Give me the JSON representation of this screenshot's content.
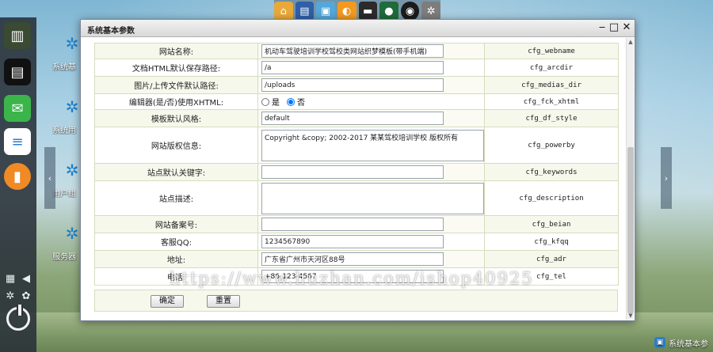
{
  "window": {
    "title": "系统基本参数"
  },
  "form": {
    "rows": [
      {
        "label": "网站名称:",
        "value": "机动车驾驶培训学校驾校类网站织梦模板(带手机端)",
        "key": "cfg_webname",
        "type": "text"
      },
      {
        "label": "文档HTML默认保存路径:",
        "value": "/a",
        "key": "cfg_arcdir",
        "type": "text"
      },
      {
        "label": "图片/上传文件默认路径:",
        "value": "/uploads",
        "key": "cfg_medias_dir",
        "type": "text"
      },
      {
        "label": "编辑器(是/否)使用XHTML:",
        "key": "cfg_fck_xhtml",
        "type": "radio",
        "option_yes": "是",
        "option_no": "否",
        "selected": "否"
      },
      {
        "label": "模板默认风格:",
        "value": "default",
        "key": "cfg_df_style",
        "type": "text"
      },
      {
        "label": "网站版权信息:",
        "value": "Copyright &copy; 2002-2017 某某驾校培训学校 版权所有",
        "key": "cfg_powerby",
        "type": "textarea"
      },
      {
        "label": "站点默认关键字:",
        "value": "",
        "key": "cfg_keywords",
        "type": "text"
      },
      {
        "label": "站点描述:",
        "value": "",
        "key": "cfg_description",
        "type": "textarea"
      },
      {
        "label": "网站备案号:",
        "value": "",
        "key": "cfg_beian",
        "type": "text"
      },
      {
        "label": "客服QQ:",
        "value": "1234567890",
        "key": "cfg_kfqq",
        "type": "text"
      },
      {
        "label": "地址:",
        "value": "广东省广州市天河区88号",
        "key": "cfg_adr",
        "type": "text"
      },
      {
        "label": "电话:",
        "value": "+86-123-4567",
        "key": "cfg_tel",
        "type": "text"
      }
    ],
    "confirm_label": "确定",
    "reset_label": "重置"
  },
  "desktop": {
    "shortcuts": [
      "系统基",
      "系统用",
      "用户组",
      "服务器"
    ],
    "taskbar_label": "系统基本参",
    "watermark": "https://www.huzhan.com/ishop40925"
  },
  "icons": {
    "top_dock": [
      "home-icon",
      "document-icon",
      "toolbox-icon",
      "orange-icon",
      "card-icon",
      "person-icon",
      "globe-icon",
      "gear-icon"
    ],
    "sidebar": [
      "bookshelf-icon",
      "notepad-icon",
      "chat-icon",
      "toggle-icon",
      "paper-icon"
    ],
    "tools": [
      "grid-icon",
      "volume-icon",
      "gear-icon",
      "palette-icon",
      "power-icon"
    ]
  },
  "colors": {
    "sidebar_bg": "#283038",
    "chat_green": "#3bb54a",
    "toggle_blue": "#2a7fd0",
    "paper_orange": "#f08a24",
    "row_alt": "#f7f8ec"
  }
}
